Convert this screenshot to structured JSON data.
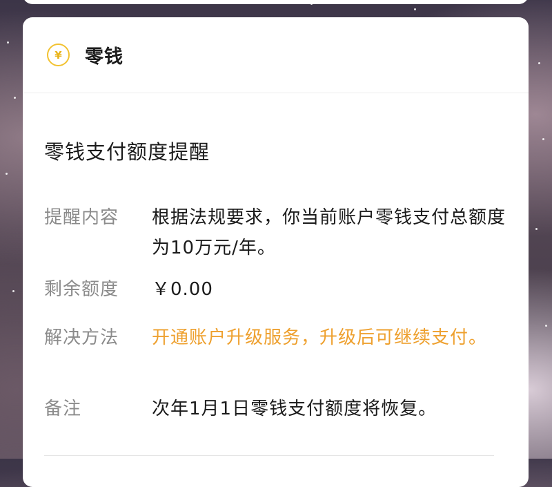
{
  "header": {
    "icon_symbol": "¥",
    "title": "零钱"
  },
  "notice": {
    "title": "零钱支付额度提醒",
    "rows": [
      {
        "label": "提醒内容",
        "value": "根据法规要求，你当前账户零钱支付总额度为10万元/年。"
      },
      {
        "label": "剩余额度",
        "value": "￥0.00"
      },
      {
        "label": "解决方法",
        "value": "开通账户升级服务，升级后可继续支付。"
      },
      {
        "label": "备注",
        "value": "次年1月1日零钱支付额度将恢复。"
      }
    ]
  },
  "colors": {
    "coin_ring": "#f2c230",
    "link_orange": "#eea02e",
    "label_gray": "#8b8b8b"
  },
  "icons": {
    "coin": "yuan-coin-icon"
  }
}
